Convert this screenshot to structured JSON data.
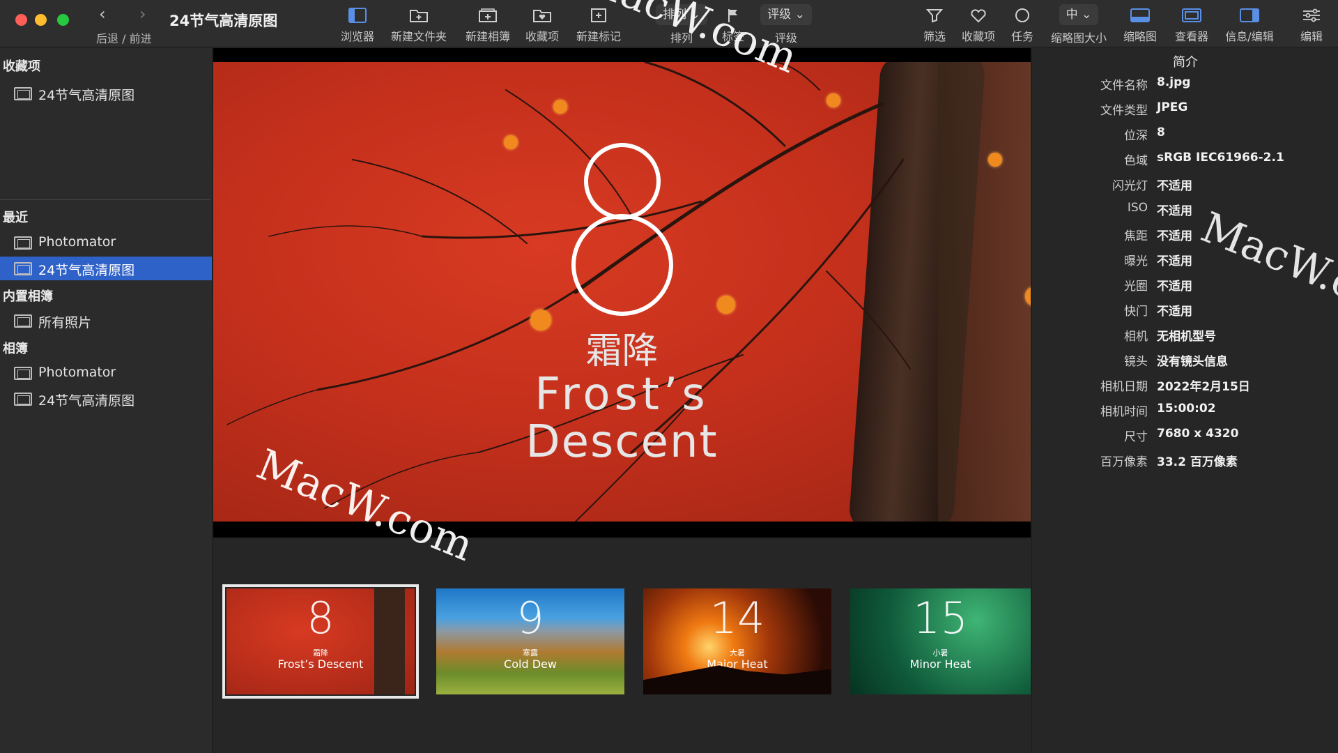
{
  "window": {
    "title": "24节气高清原图",
    "nav_label": "后退 / 前进"
  },
  "toolbar": {
    "browser": "浏览器",
    "new_folder": "新建文件夹",
    "new_album": "新建相簿",
    "favorites": "收藏项",
    "new_marker": "新建标记",
    "sort": "排列",
    "tag": "标签",
    "rating": "评级",
    "filter": "筛选",
    "favorite_item": "收藏项",
    "task": "任务",
    "thumb_size": "缩略图大小",
    "thumb_size_value": "中",
    "thumbnails": "缩略图",
    "viewer": "查看器",
    "info_edit": "信息/编辑",
    "edit": "编辑"
  },
  "sidebar": {
    "favorites_header": "收藏项",
    "favorites": [
      {
        "label": "24节气高清原图"
      }
    ],
    "recent_header": "最近",
    "recent": [
      {
        "label": "Photomator"
      },
      {
        "label": "24节气高清原图",
        "selected": true
      }
    ],
    "builtin_header": "内置相簿",
    "builtin": [
      {
        "label": "所有照片"
      }
    ],
    "albums_header": "相簿",
    "albums": [
      {
        "label": "Photomator"
      },
      {
        "label": "24节气高清原图"
      }
    ]
  },
  "viewer": {
    "number": "8",
    "title_cn": "霜降",
    "title_en_line1": "Frost’s",
    "title_en_line2": "Descent"
  },
  "filmstrip": [
    {
      "number": "8",
      "cn": "霜降",
      "en": "Frost’s Descent",
      "selected": true
    },
    {
      "number": "9",
      "cn": "寒露",
      "en": "Cold Dew",
      "selected": false
    },
    {
      "number": "14",
      "cn": "大暑",
      "en": "Major Heat",
      "selected": false
    },
    {
      "number": "15",
      "cn": "小暑",
      "en": "Minor Heat",
      "selected": false
    }
  ],
  "info": {
    "title": "简介",
    "rows": [
      {
        "key": "文件名称",
        "value": "8.jpg"
      },
      {
        "key": "文件类型",
        "value": "JPEG"
      },
      {
        "key": "位深",
        "value": "8"
      },
      {
        "key": "色域",
        "value": "sRGB IEC61966-2.1"
      },
      {
        "key": "闪光灯",
        "value": "不适用"
      },
      {
        "key": "ISO",
        "value": "不适用"
      },
      {
        "key": "焦距",
        "value": "不适用"
      },
      {
        "key": "曝光",
        "value": "不适用"
      },
      {
        "key": "光圈",
        "value": "不适用"
      },
      {
        "key": "快门",
        "value": "不适用"
      },
      {
        "key": "相机",
        "value": "无相机型号"
      },
      {
        "key": "镜头",
        "value": "没有镜头信息"
      },
      {
        "key": "相机日期",
        "value": "2022年2月15日"
      },
      {
        "key": "相机时间",
        "value": "15:00:02"
      },
      {
        "key": "尺寸",
        "value": "7680 x 4320"
      },
      {
        "key": "百万像素",
        "value": "33.2 百万像素"
      }
    ]
  },
  "watermark": "MacW.com",
  "colors": {
    "selection": "#2f62c8",
    "photo_red": "#c4301c",
    "persimmon": "#f08a1e"
  }
}
